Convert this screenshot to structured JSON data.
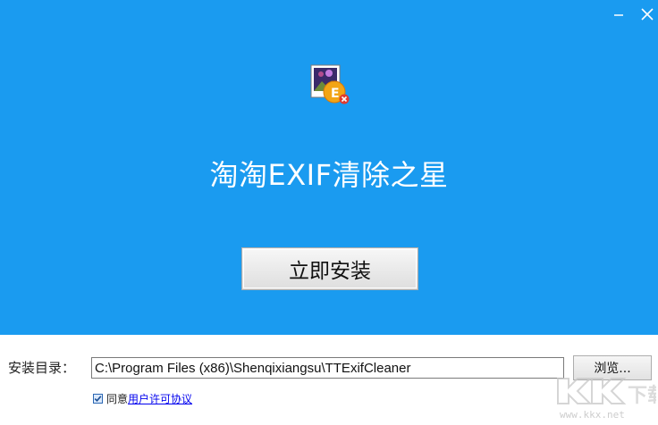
{
  "window": {
    "minimize_icon": "minimize-icon",
    "close_icon": "close-icon"
  },
  "header": {
    "app_icon": "app-exif-icon",
    "title": "淘淘EXIF清除之星"
  },
  "install": {
    "label": "立即安装"
  },
  "directory": {
    "label": "安装目录：",
    "value": "C:\\Program Files (x86)\\Shenqixiangsu\\TTExifCleaner",
    "browse_label": "浏览..."
  },
  "agreement": {
    "checked": true,
    "text": "同意",
    "link_text": "用户许可协议"
  },
  "watermark": {
    "logo": "KK下载",
    "url": "www.kkx.net"
  },
  "colors": {
    "banner": "#1a9bf0",
    "button_face": "#e8e8e8",
    "link": "#0000ee"
  }
}
